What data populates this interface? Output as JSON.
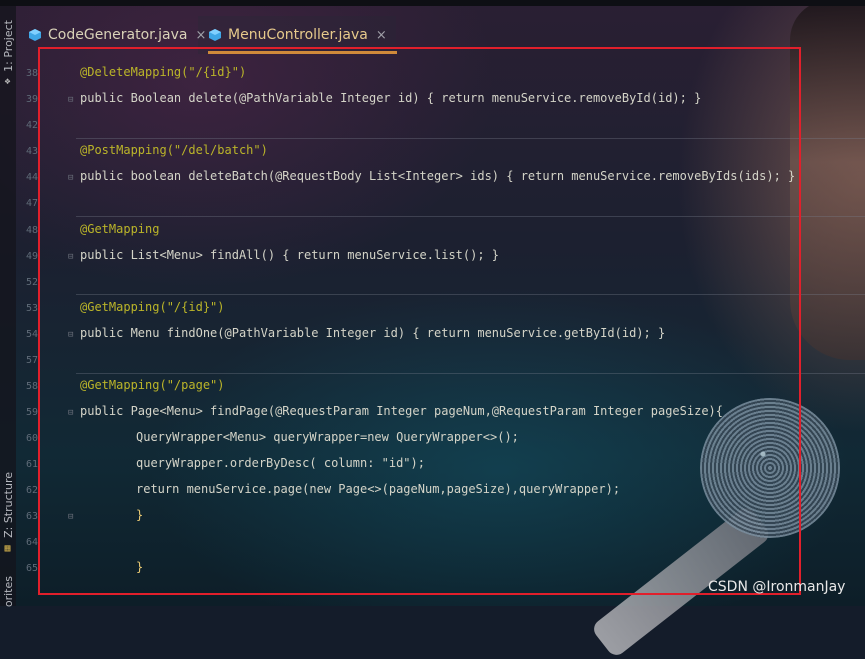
{
  "sidebar": {
    "project_label": "1: Project",
    "structure_label": "Z: Structure",
    "favorites_label": "orites"
  },
  "tabs": [
    {
      "label": "CodeGenerator.java",
      "close": "×",
      "active": false
    },
    {
      "label": "MenuController.java",
      "close": "×",
      "active": true
    }
  ],
  "code_lines": [
    {
      "num": "38",
      "text": "@DeleteMapping(\"/{id}\")"
    },
    {
      "num": "39",
      "text": "public Boolean delete(@PathVariable Integer id) { return menuService.removeById(id); }"
    },
    {
      "num": "42",
      "text": ""
    },
    {
      "num": "43",
      "text": "@PostMapping(\"/del/batch\")"
    },
    {
      "num": "44",
      "text": "public boolean deleteBatch(@RequestBody List<Integer> ids) { return menuService.removeByIds(ids); }"
    },
    {
      "num": "47",
      "text": ""
    },
    {
      "num": "48",
      "text": "@GetMapping"
    },
    {
      "num": "49",
      "text": "public List<Menu> findAll() { return menuService.list(); }"
    },
    {
      "num": "52",
      "text": ""
    },
    {
      "num": "53",
      "text": "@GetMapping(\"/{id}\")"
    },
    {
      "num": "54",
      "text": "public Menu findOne(@PathVariable Integer id) { return menuService.getById(id); }"
    },
    {
      "num": "57",
      "text": ""
    },
    {
      "num": "58",
      "text": "@GetMapping(\"/page\")"
    },
    {
      "num": "59",
      "text": "public Page<Menu> findPage(@RequestParam Integer pageNum,@RequestParam Integer pageSize){"
    },
    {
      "num": "60",
      "text": "QueryWrapper<Menu> queryWrapper=new QueryWrapper<>();"
    },
    {
      "num": "61",
      "text": "queryWrapper.orderByDesc( column: \"id\");"
    },
    {
      "num": "62",
      "text": "return menuService.page(new Page<>(pageNum,pageSize),queryWrapper);"
    },
    {
      "num": "63",
      "text": "}"
    },
    {
      "num": "64",
      "text": ""
    },
    {
      "num": "65",
      "text": "}"
    }
  ],
  "watermark": "CSDN @IronmanJay",
  "colors": {
    "highlight_box": "#e11f2b",
    "tab_underline": "#d08a3a"
  }
}
